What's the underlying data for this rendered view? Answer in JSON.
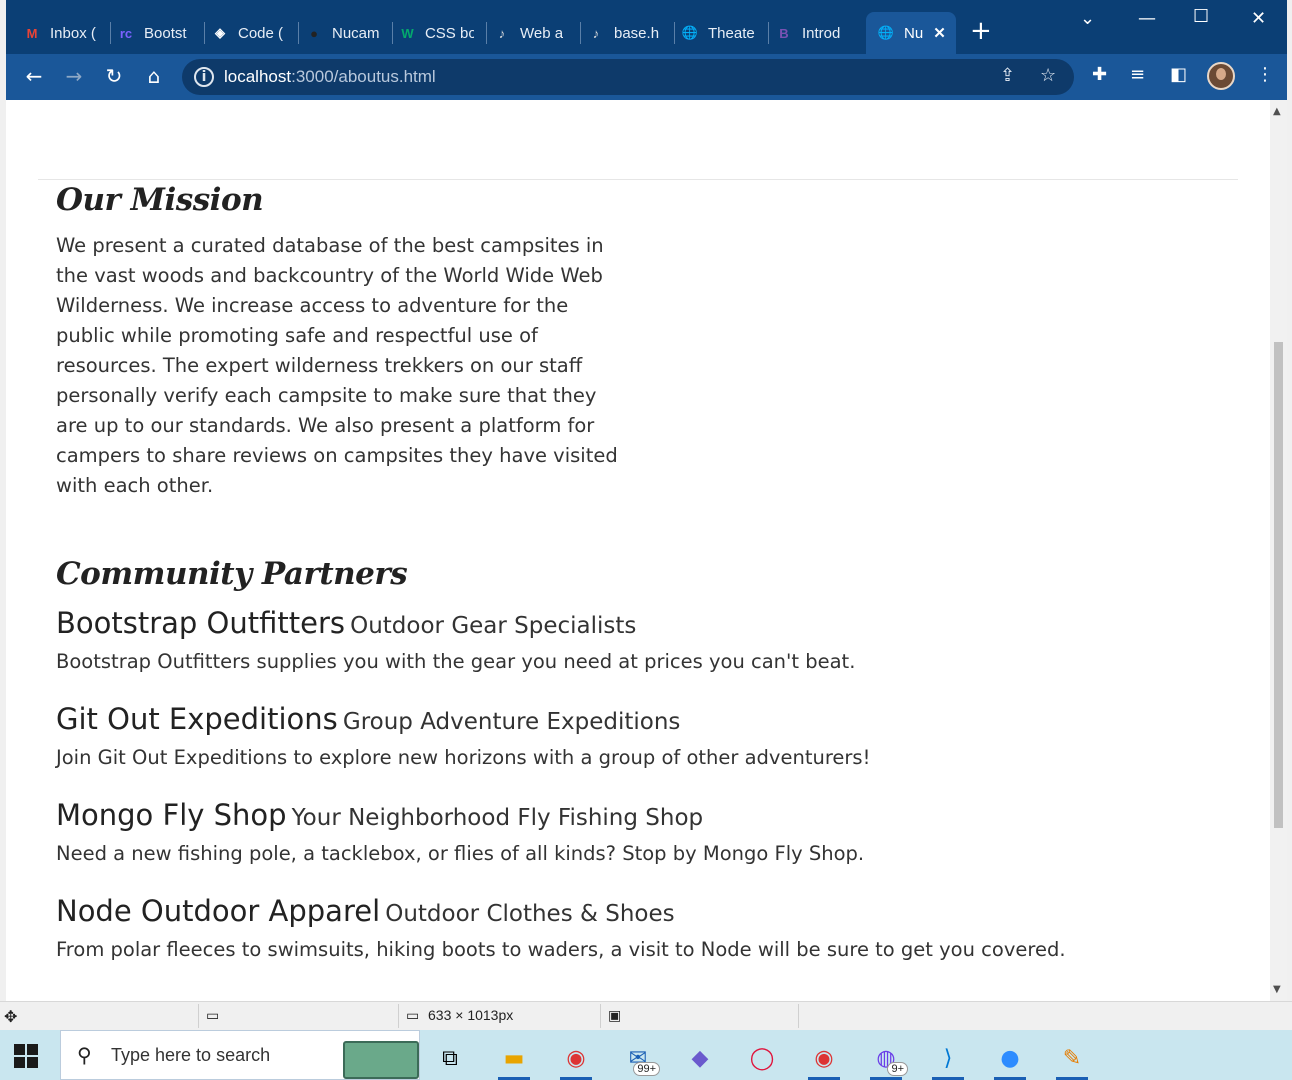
{
  "browser": {
    "tabs": [
      {
        "label": "Inbox (",
        "icon": "gmail-icon",
        "glyph": "M",
        "color": "#ea4335"
      },
      {
        "label": "Bootst",
        "icon": "bootstrap-site-icon",
        "glyph": "rc",
        "color": "#7b61ff"
      },
      {
        "label": "Code (",
        "icon": "codepen-icon",
        "glyph": "◈",
        "color": "#ffffff"
      },
      {
        "label": "Nucam",
        "icon": "github-icon",
        "glyph": "●",
        "color": "#222222"
      },
      {
        "label": "CSS bo",
        "icon": "w3schools-icon",
        "glyph": "W",
        "color": "#04aa6d"
      },
      {
        "label": "Web a",
        "icon": "guitar-icon",
        "glyph": "♪",
        "color": "#dddddd"
      },
      {
        "label": "base.h",
        "icon": "guitar-icon",
        "glyph": "♪",
        "color": "#dddddd"
      },
      {
        "label": "Theate",
        "icon": "globe-icon",
        "glyph": "🌐",
        "color": "#ffffff"
      },
      {
        "label": "Introd",
        "icon": "bootstrap-icon",
        "glyph": "B",
        "color": "#7952b3"
      },
      {
        "label": "Nu",
        "icon": "globe-icon",
        "glyph": "🌐",
        "color": "#ffffff",
        "active": true
      }
    ],
    "url_host": "localhost",
    "url_path": ":3000/aboutus.html"
  },
  "page": {
    "mission": {
      "heading": "Our Mission",
      "text": "We present a curated database of the best campsites in the vast woods and backcountry of the World Wide Web Wilderness. We increase access to adventure for the public while promoting safe and respectful use of resources. The expert wilderness trekkers on our staff personally verify each campsite to make sure that they are up to our standards. We also present a platform for campers to share reviews on campsites they have visited with each other."
    },
    "partners": {
      "heading": "Community Partners",
      "items": [
        {
          "name": "Bootstrap Outfitters",
          "tagline": "Outdoor Gear Specialists",
          "description": "Bootstrap Outfitters supplies you with the gear you need at prices you can't beat."
        },
        {
          "name": "Git Out Expeditions",
          "tagline": "Group Adventure Expeditions",
          "description": "Join Git Out Expeditions to explore new horizons with a group of other adventurers!"
        },
        {
          "name": "Mongo Fly Shop",
          "tagline": "Your Neighborhood Fly Fishing Shop",
          "description": "Need a new fishing pole, a tacklebox, or flies of all kinds? Stop by Mongo Fly Shop."
        },
        {
          "name": "Node Outdoor Apparel",
          "tagline": "Outdoor Clothes & Shoes",
          "description": "From polar fleeces to swimsuits, hiking boots to waders, a visit to Node will be sure to get you covered."
        }
      ]
    }
  },
  "statusbar": {
    "dimensions": "633 × 1013px"
  },
  "taskbar": {
    "search_placeholder": "Type here to search",
    "mail_badge": "99+",
    "messenger_badge": "9+"
  }
}
